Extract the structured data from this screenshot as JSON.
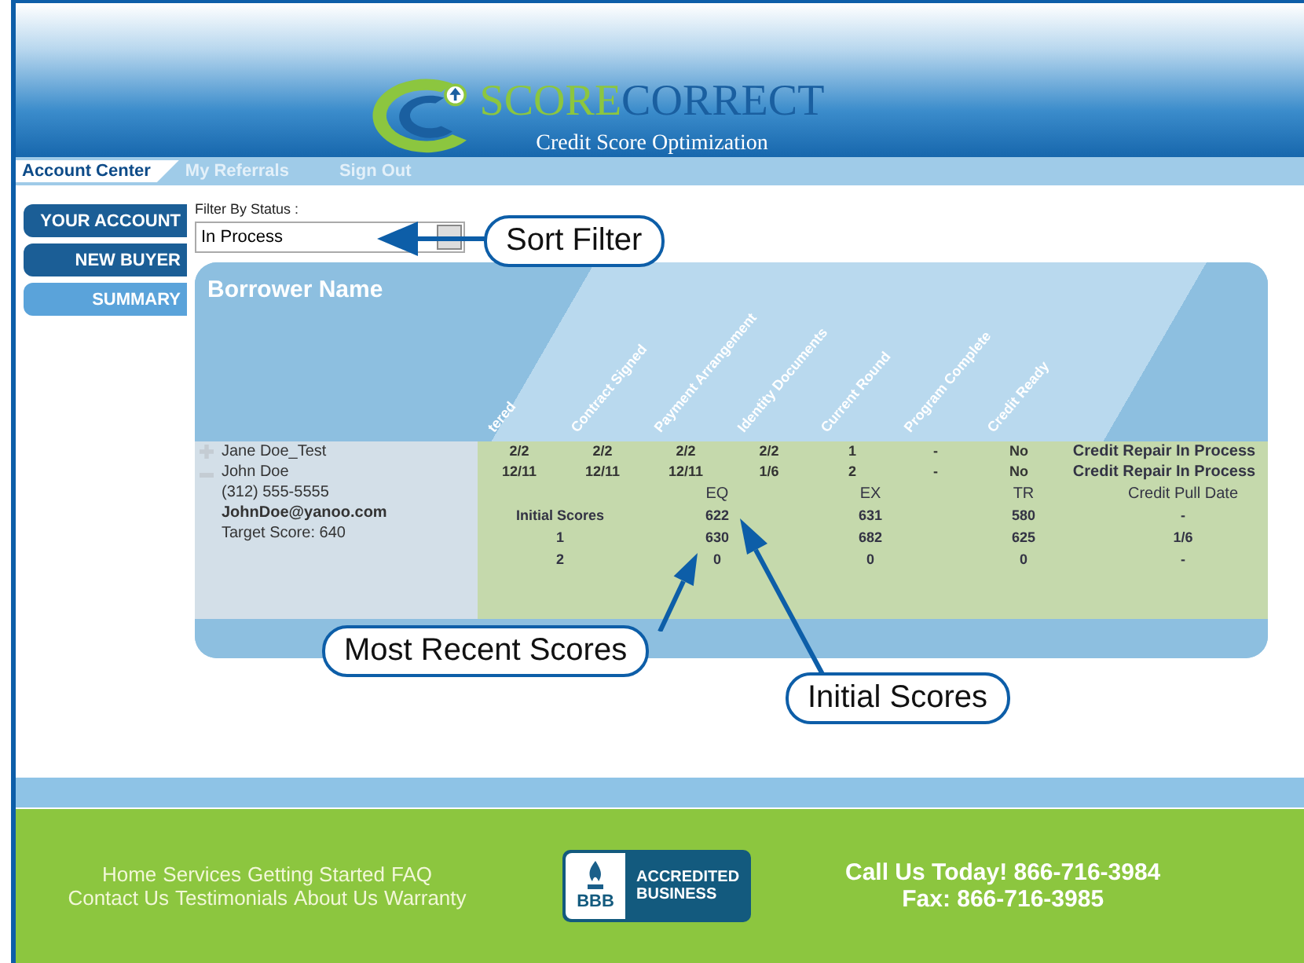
{
  "logo": {
    "brand_part_1": "SCORE",
    "brand_part_2": "CORRECT",
    "tagline": "Credit Score Optimization"
  },
  "nav_tabs": [
    {
      "label": "Account Center",
      "selected": true
    },
    {
      "label": "My Referrals",
      "selected": false
    },
    {
      "label": "Sign Out",
      "selected": false
    }
  ],
  "sidebar": [
    {
      "label": "YOUR ACCOUNT",
      "selected": false
    },
    {
      "label": "NEW BUYER",
      "selected": false
    },
    {
      "label": "SUMMARY",
      "selected": true
    }
  ],
  "filter": {
    "label": "Filter By Status :",
    "value": "In Process"
  },
  "table": {
    "title": "Borrower Name",
    "columns": [
      "tered",
      "Contract Signed",
      "Payment Arrangement",
      "Identity Documents",
      "Current Round",
      "Program Complete",
      "Credit Ready"
    ],
    "rows": [
      {
        "name": "Jane Doe_Test",
        "expanded": false,
        "values": [
          "2/2",
          "2/2",
          "2/2",
          "2/2",
          "1",
          "-",
          "No"
        ],
        "status": "Credit Repair In Process"
      },
      {
        "name": "John Doe",
        "expanded": true,
        "values": [
          "12/11",
          "12/11",
          "12/11",
          "1/6",
          "2",
          "-",
          "No"
        ],
        "status": "Credit Repair In Process",
        "details": [
          "(312) 555-5555",
          "JohnDoe@yanoo.com",
          "Target Score: 640"
        ],
        "scores": {
          "columns": [
            "EQ",
            "EX",
            "TR",
            "Credit Pull Date"
          ],
          "rows": [
            {
              "label": "Initial Scores",
              "values": [
                "622",
                "631",
                "580",
                "-"
              ]
            },
            {
              "label": "1",
              "values": [
                "630",
                "682",
                "625",
                "1/6"
              ]
            },
            {
              "label": "2",
              "values": [
                "0",
                "0",
                "0",
                "-"
              ]
            }
          ]
        }
      }
    ]
  },
  "callouts": [
    {
      "kind": "filter",
      "text": "Sort Filter"
    },
    {
      "kind": "initial",
      "text": "Initial Scores"
    },
    {
      "kind": "recent",
      "text": "Most Recent Scores"
    }
  ],
  "footer": {
    "links": [
      [
        "Home",
        "Services",
        "Getting Started",
        "FAQ"
      ],
      [
        "Contact Us",
        "Testimonials",
        "About Us",
        "Warranty"
      ]
    ],
    "badge": {
      "logo": "BBB",
      "text_1": "ACCREDITED",
      "text_2": "BUSINESS"
    },
    "phone": "Call Us Today! 866-716-3984",
    "fax": "Fax: 866-716-3985"
  }
}
